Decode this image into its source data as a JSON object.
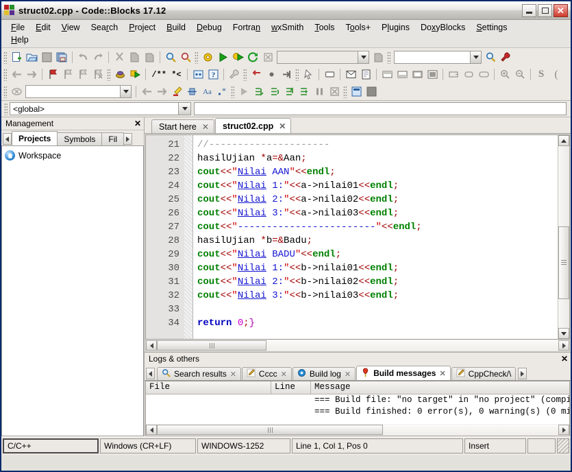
{
  "window": {
    "title": "struct02.cpp - Code::Blocks 17.12",
    "minimize_label": "_",
    "maximize_label": "□",
    "close_label": "✕"
  },
  "menu": {
    "items": [
      {
        "label": "File",
        "accel": "F"
      },
      {
        "label": "Edit",
        "accel": "E"
      },
      {
        "label": "View",
        "accel": "V"
      },
      {
        "label": "Search",
        "accel": "r"
      },
      {
        "label": "Project",
        "accel": "P"
      },
      {
        "label": "Build",
        "accel": "B"
      },
      {
        "label": "Debug",
        "accel": "D"
      },
      {
        "label": "Fortran",
        "accel": "n"
      },
      {
        "label": "wxSmith",
        "accel": "w"
      },
      {
        "label": "Tools",
        "accel": "T"
      },
      {
        "label": "Tools+",
        "accel": "o"
      },
      {
        "label": "Plugins",
        "accel": "l"
      },
      {
        "label": "DoxyBlocks",
        "accel": "x"
      },
      {
        "label": "Settings",
        "accel": "S"
      },
      {
        "label": "Help",
        "accel": "H"
      }
    ]
  },
  "toolbar": {
    "row1": [
      {
        "name": "new-file-icon",
        "title": "New file"
      },
      {
        "name": "open-file-icon",
        "title": "Open"
      },
      {
        "name": "save-icon",
        "title": "Save"
      },
      {
        "name": "save-all-icon",
        "title": "Save all"
      },
      {
        "name": "undo-icon",
        "title": "Undo"
      },
      {
        "name": "redo-icon",
        "title": "Redo"
      },
      {
        "name": "cut-icon",
        "title": "Cut"
      },
      {
        "name": "copy-icon",
        "title": "Copy"
      },
      {
        "name": "paste-icon",
        "title": "Paste"
      },
      {
        "name": "find-icon",
        "title": "Find"
      },
      {
        "name": "replace-icon",
        "title": "Replace"
      },
      {
        "name": "build-icon",
        "title": "Build"
      },
      {
        "name": "run-icon",
        "title": "Run"
      },
      {
        "name": "build-and-run-icon",
        "title": "Build and run"
      },
      {
        "name": "rebuild-icon",
        "title": "Rebuild"
      },
      {
        "name": "abort-icon",
        "title": "Abort"
      }
    ],
    "build_target_value": "",
    "search_value": "",
    "search_placeholder": "",
    "row2": [
      {
        "name": "back-icon",
        "title": "Back"
      },
      {
        "name": "forward-icon",
        "title": "Forward"
      },
      {
        "name": "bookmark-toggle-icon",
        "title": "Toggle bookmark"
      },
      {
        "name": "bookmark-prev-icon",
        "title": "Previous bookmark"
      },
      {
        "name": "bookmark-next-icon",
        "title": "Next bookmark"
      },
      {
        "name": "bookmark-clear-icon",
        "title": "Clear bookmarks"
      },
      {
        "name": "debug-continue-icon",
        "title": "Debug / Continue"
      },
      {
        "name": "run-to-cursor-icon",
        "title": "Run to cursor"
      },
      {
        "name": "comment-icon",
        "title": "Comment"
      },
      {
        "name": "doxyblocks-icon",
        "title": "DoxyBlocks"
      },
      {
        "name": "help-icon",
        "title": "Help"
      },
      {
        "name": "tools-icon",
        "title": "Tools"
      },
      {
        "name": "wrap-icon",
        "title": "Wrap"
      },
      {
        "name": "record-icon",
        "title": "Record"
      },
      {
        "name": "play-macro-icon",
        "title": "Play macro"
      },
      {
        "name": "pointer-icon",
        "title": "Select"
      },
      {
        "name": "panel-icon",
        "title": "Panel"
      },
      {
        "name": "dialog-icon",
        "title": "Dialog"
      },
      {
        "name": "frame-icon",
        "title": "Frame"
      },
      {
        "name": "layout-top-icon",
        "title": "Layout top"
      },
      {
        "name": "layout-bottom-icon",
        "title": "Layout bottom"
      },
      {
        "name": "layout-center-icon",
        "title": "Layout center"
      },
      {
        "name": "layout-fill-icon",
        "title": "Layout fill"
      },
      {
        "name": "align-left-icon",
        "title": "Align left"
      },
      {
        "name": "align-center-icon",
        "title": "Align center"
      },
      {
        "name": "align-expand-icon",
        "title": "Expand"
      },
      {
        "name": "zoom-in-icon",
        "title": "Zoom in"
      },
      {
        "name": "zoom-out-icon",
        "title": "Zoom out"
      }
    ],
    "row3": [
      {
        "name": "clear-search-icon",
        "title": "Clear"
      },
      {
        "name": "goto-prev-icon",
        "title": "Previous"
      },
      {
        "name": "goto-next-icon",
        "title": "Next"
      },
      {
        "name": "highlight-icon",
        "title": "Highlight"
      },
      {
        "name": "selection-icon",
        "title": "Selection"
      },
      {
        "name": "match-case-icon",
        "title": "Match case"
      },
      {
        "name": "regex-icon",
        "title": "Regular expression"
      },
      {
        "name": "debug-run-icon",
        "title": "Debug run"
      },
      {
        "name": "step-into-icon",
        "title": "Step into"
      },
      {
        "name": "step-over-icon",
        "title": "Step over"
      },
      {
        "name": "step-out-icon",
        "title": "Step out"
      },
      {
        "name": "next-instruction-icon",
        "title": "Next instruction"
      },
      {
        "name": "break-icon",
        "title": "Break"
      },
      {
        "name": "stop-debugger-icon",
        "title": "Stop debugger"
      },
      {
        "name": "debug-window-icon",
        "title": "Debugging windows"
      },
      {
        "name": "debug-info-icon",
        "title": "Various info"
      }
    ],
    "incremental_search_value": ""
  },
  "scope": {
    "value": "<global>",
    "function_value": ""
  },
  "management": {
    "title": "Management",
    "close_label": "✕",
    "tabs": [
      {
        "label": "Projects",
        "active": true
      },
      {
        "label": "Symbols",
        "active": false
      },
      {
        "label": "Fil",
        "active": false
      }
    ],
    "tree": [
      {
        "label": "Workspace",
        "icon": "workspace-home-icon"
      }
    ]
  },
  "editor": {
    "tabs": [
      {
        "label": "Start here",
        "active": false,
        "close": "✕"
      },
      {
        "label": "struct02.cpp",
        "active": true,
        "close": "✕"
      }
    ],
    "first_line": 21,
    "lines": [
      {
        "n": 21,
        "tokens": [
          {
            "t": "//---------------------",
            "c": "cmt"
          }
        ]
      },
      {
        "n": 22,
        "tokens": [
          {
            "t": "hasilUjian ",
            "c": "pln"
          },
          {
            "t": "*",
            "c": "op"
          },
          {
            "t": "a",
            "c": "pln"
          },
          {
            "t": "=",
            "c": "op"
          },
          {
            "t": "&",
            "c": "op"
          },
          {
            "t": "Aan",
            "c": "pln"
          },
          {
            "t": ";",
            "c": "op"
          }
        ]
      },
      {
        "n": 23,
        "tokens": [
          {
            "t": "cout",
            "c": "kw"
          },
          {
            "t": "<<",
            "c": "op"
          },
          {
            "t": "\"",
            "c": "q"
          },
          {
            "t": "Nilai",
            "c": "str spell"
          },
          {
            "t": " AAN",
            "c": "str"
          },
          {
            "t": "\"",
            "c": "q"
          },
          {
            "t": "<<",
            "c": "op"
          },
          {
            "t": "endl",
            "c": "kw"
          },
          {
            "t": ";",
            "c": "op"
          }
        ]
      },
      {
        "n": 24,
        "tokens": [
          {
            "t": "cout",
            "c": "kw"
          },
          {
            "t": "<<",
            "c": "op"
          },
          {
            "t": "\"",
            "c": "q"
          },
          {
            "t": "Nilai",
            "c": "str spell"
          },
          {
            "t": " 1:",
            "c": "str"
          },
          {
            "t": "\"",
            "c": "q"
          },
          {
            "t": "<<",
            "c": "op"
          },
          {
            "t": "a->nilai01",
            "c": "pln"
          },
          {
            "t": "<<",
            "c": "op"
          },
          {
            "t": "endl",
            "c": "kw"
          },
          {
            "t": ";",
            "c": "op"
          }
        ]
      },
      {
        "n": 25,
        "tokens": [
          {
            "t": "cout",
            "c": "kw"
          },
          {
            "t": "<<",
            "c": "op"
          },
          {
            "t": "\"",
            "c": "q"
          },
          {
            "t": "Nilai",
            "c": "str spell"
          },
          {
            "t": " 2:",
            "c": "str"
          },
          {
            "t": "\"",
            "c": "q"
          },
          {
            "t": "<<",
            "c": "op"
          },
          {
            "t": "a->nilai02",
            "c": "pln"
          },
          {
            "t": "<<",
            "c": "op"
          },
          {
            "t": "endl",
            "c": "kw"
          },
          {
            "t": ";",
            "c": "op"
          }
        ]
      },
      {
        "n": 26,
        "tokens": [
          {
            "t": "cout",
            "c": "kw"
          },
          {
            "t": "<<",
            "c": "op"
          },
          {
            "t": "\"",
            "c": "q"
          },
          {
            "t": "Nilai",
            "c": "str spell"
          },
          {
            "t": " 3:",
            "c": "str"
          },
          {
            "t": "\"",
            "c": "q"
          },
          {
            "t": "<<",
            "c": "op"
          },
          {
            "t": "a->nilai03",
            "c": "pln"
          },
          {
            "t": "<<",
            "c": "op"
          },
          {
            "t": "endl",
            "c": "kw"
          },
          {
            "t": ";",
            "c": "op"
          }
        ]
      },
      {
        "n": 27,
        "tokens": [
          {
            "t": "cout",
            "c": "kw"
          },
          {
            "t": "<<",
            "c": "op"
          },
          {
            "t": "\"",
            "c": "q"
          },
          {
            "t": "------------------------",
            "c": "str"
          },
          {
            "t": "\"",
            "c": "q"
          },
          {
            "t": "<<",
            "c": "op"
          },
          {
            "t": "endl",
            "c": "kw"
          },
          {
            "t": ";",
            "c": "op"
          }
        ]
      },
      {
        "n": 28,
        "tokens": [
          {
            "t": "hasilUjian ",
            "c": "pln"
          },
          {
            "t": "*",
            "c": "op"
          },
          {
            "t": "b",
            "c": "pln"
          },
          {
            "t": "=",
            "c": "op"
          },
          {
            "t": "&",
            "c": "op"
          },
          {
            "t": "Badu",
            "c": "pln"
          },
          {
            "t": ";",
            "c": "op"
          }
        ]
      },
      {
        "n": 29,
        "tokens": [
          {
            "t": "cout",
            "c": "kw"
          },
          {
            "t": "<<",
            "c": "op"
          },
          {
            "t": "\"",
            "c": "q"
          },
          {
            "t": "Nilai",
            "c": "str spell"
          },
          {
            "t": " BADU",
            "c": "str"
          },
          {
            "t": "\"",
            "c": "q"
          },
          {
            "t": "<<",
            "c": "op"
          },
          {
            "t": "endl",
            "c": "kw"
          },
          {
            "t": ";",
            "c": "op"
          }
        ]
      },
      {
        "n": 30,
        "tokens": [
          {
            "t": "cout",
            "c": "kw"
          },
          {
            "t": "<<",
            "c": "op"
          },
          {
            "t": "\"",
            "c": "q"
          },
          {
            "t": "Nilai",
            "c": "str spell"
          },
          {
            "t": " 1:",
            "c": "str"
          },
          {
            "t": "\"",
            "c": "q"
          },
          {
            "t": "<<",
            "c": "op"
          },
          {
            "t": "b->nilai01",
            "c": "pln"
          },
          {
            "t": "<<",
            "c": "op"
          },
          {
            "t": "endl",
            "c": "kw"
          },
          {
            "t": ";",
            "c": "op"
          }
        ]
      },
      {
        "n": 31,
        "tokens": [
          {
            "t": "cout",
            "c": "kw"
          },
          {
            "t": "<<",
            "c": "op"
          },
          {
            "t": "\"",
            "c": "q"
          },
          {
            "t": "Nilai",
            "c": "str spell"
          },
          {
            "t": " 2:",
            "c": "str"
          },
          {
            "t": "\"",
            "c": "q"
          },
          {
            "t": "<<",
            "c": "op"
          },
          {
            "t": "b->nilai02",
            "c": "pln"
          },
          {
            "t": "<<",
            "c": "op"
          },
          {
            "t": "endl",
            "c": "kw"
          },
          {
            "t": ";",
            "c": "op"
          }
        ]
      },
      {
        "n": 32,
        "tokens": [
          {
            "t": "cout",
            "c": "kw"
          },
          {
            "t": "<<",
            "c": "op"
          },
          {
            "t": "\"",
            "c": "q"
          },
          {
            "t": "Nilai",
            "c": "str spell"
          },
          {
            "t": " 3:",
            "c": "str"
          },
          {
            "t": "\"",
            "c": "q"
          },
          {
            "t": "<<",
            "c": "op"
          },
          {
            "t": "b->nilai03",
            "c": "pln"
          },
          {
            "t": "<<",
            "c": "op"
          },
          {
            "t": "endl",
            "c": "kw"
          },
          {
            "t": ";",
            "c": "op"
          }
        ]
      },
      {
        "n": 33,
        "tokens": []
      },
      {
        "n": 34,
        "tokens": [
          {
            "t": "return ",
            "c": "kwb"
          },
          {
            "t": "0",
            "c": "num"
          },
          {
            "t": ";",
            "c": "op"
          },
          {
            "t": "}",
            "c": "brace"
          }
        ]
      }
    ]
  },
  "logs": {
    "title": "Logs & others",
    "close_label": "✕",
    "tabs": [
      {
        "label": "Search results",
        "icon": "search-icon",
        "active": false,
        "close": "✕"
      },
      {
        "label": "Cccc",
        "icon": "pencil-icon",
        "active": false,
        "close": "✕"
      },
      {
        "label": "Build log",
        "icon": "gear-blue-icon",
        "active": false,
        "close": "✕"
      },
      {
        "label": "Build messages",
        "icon": "pin-icon",
        "active": true,
        "close": "✕"
      },
      {
        "label": "CppCheck/\\",
        "icon": "pencil-icon",
        "active": false,
        "close": ""
      }
    ],
    "columns": [
      "File",
      "Line",
      "Message"
    ],
    "rows": [
      {
        "file": "",
        "line": "",
        "message": "=== Build file: \"no target\" in \"no project\" (compil"
      },
      {
        "file": "",
        "line": "",
        "message": "=== Build finished: 0 error(s), 0 warning(s) (0 min"
      }
    ]
  },
  "statusbar": {
    "language": "C/C++",
    "eol": "Windows (CR+LF)",
    "encoding": "WINDOWS-1252",
    "position": "Line 1, Col 1, Pos 0",
    "mode": "Insert",
    "extra": ""
  }
}
